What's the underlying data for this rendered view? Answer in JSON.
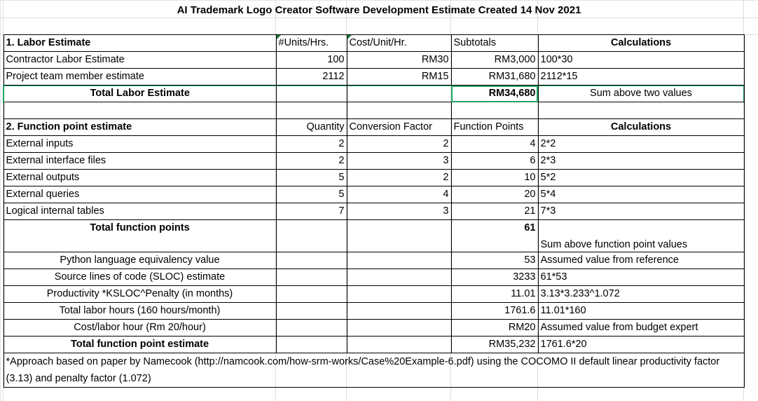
{
  "title": "AI Trademark Logo Creator Software Development Estimate Created 14 Nov 2021",
  "labor": {
    "header": [
      "1. Labor Estimate",
      "#Units/Hrs.",
      "Cost/Unit/Hr.",
      "Subtotals",
      "Calculations"
    ],
    "rows": [
      [
        "Contractor Labor Estimate",
        "100",
        "RM30",
        "RM3,000",
        "100*30"
      ],
      [
        "Project team member estimate",
        "2112",
        "RM15",
        "RM31,680",
        "2112*15"
      ]
    ],
    "total": [
      "Total Labor Estimate",
      "",
      "",
      "RM34,680",
      "Sum above two values"
    ]
  },
  "function_points": {
    "header": [
      "2. Function point estimate",
      "Quantity",
      "Conversion Factor",
      "Function Points",
      "Calculations"
    ],
    "rows": [
      [
        "External inputs",
        "2",
        "2",
        "4",
        "2*2"
      ],
      [
        "External interface files",
        "2",
        "3",
        "6",
        "2*3"
      ],
      [
        "External outputs",
        "5",
        "2",
        "10",
        "5*2"
      ],
      [
        "External queries",
        "5",
        "4",
        "20",
        "5*4"
      ],
      [
        "Logical internal tables",
        "7",
        "3",
        "21",
        "7*3"
      ]
    ],
    "total": [
      "Total function points",
      "",
      "",
      "61",
      "Sum above function point values"
    ],
    "derived": [
      [
        "Python language equivalency value",
        "53",
        "Assumed value from reference"
      ],
      [
        "Source lines of code (SLOC) estimate",
        "3233",
        "61*53"
      ],
      [
        "Productivity *KSLOC^Penalty (in months)",
        "11.01",
        "3.13*3.233^1.072"
      ],
      [
        "Total labor hours (160 hours/month)",
        "1761.6",
        "11.01*160"
      ],
      [
        "Cost/labor hour (Rm 20/hour)",
        "RM20",
        "Assumed value from budget expert"
      ],
      [
        "Total function point estimate",
        "RM35,232",
        "1761.6*20"
      ]
    ]
  },
  "note": "*Approach based on paper by Namecook (http://namcook.com/how-srm-works/Case%20Example-6.pdf) using the COCOMO II default linear productivity factor (3.13) and penalty factor (1.072)",
  "colors": {
    "selection": "#21a366",
    "border": "#000000",
    "gridline": "#dcdcdc"
  }
}
